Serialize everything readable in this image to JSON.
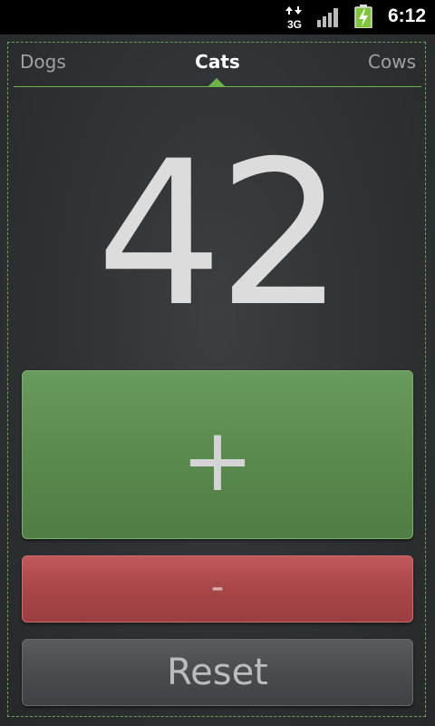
{
  "status_bar": {
    "network_type": "3G",
    "time": "6:12",
    "icons": [
      "network-3g-icon",
      "signal-strength-icon",
      "battery-charging-icon"
    ]
  },
  "tabs": [
    {
      "label": "Dogs",
      "selected": false
    },
    {
      "label": "Cats",
      "selected": true
    },
    {
      "label": "Cows",
      "selected": false
    }
  ],
  "counter": {
    "value": "42"
  },
  "buttons": {
    "increment_label": "+",
    "decrement_label": "-",
    "reset_label": "Reset"
  },
  "colors": {
    "accent": "#6fb34f",
    "increment": "#5a8a4e",
    "decrement": "#a84648",
    "reset": "#474b4e",
    "background": "#2e3133"
  }
}
